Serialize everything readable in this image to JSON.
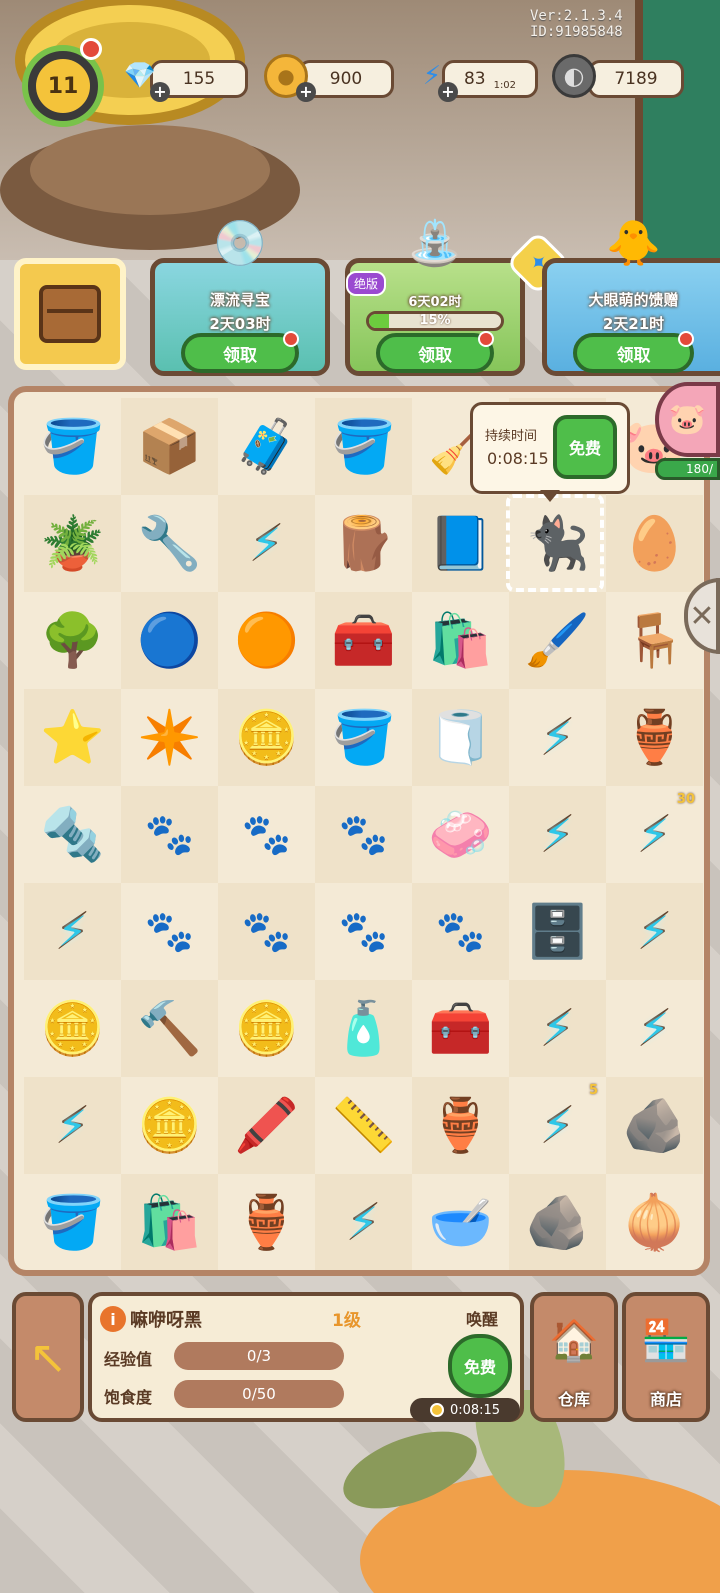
{
  "version": "Ver:2.1.3.4 ID:91985848",
  "player": {
    "level": "11"
  },
  "resources": [
    {
      "name": "gems",
      "icon": "💎",
      "color": "#e8446a",
      "value": "155"
    },
    {
      "name": "coins",
      "icon": "●",
      "color": "#f4b63a",
      "value": "900"
    },
    {
      "name": "energy",
      "icon": "⚡",
      "color": "#2e8de8",
      "value": "83",
      "timer": "1:02"
    },
    {
      "name": "seeds",
      "icon": "◐",
      "color": "#6a6a6a",
      "value": "7189"
    }
  ],
  "events": [
    {
      "title": "漂流寻宝",
      "time": "2天03时",
      "claim": "领取",
      "art": "💿"
    },
    {
      "title": "6天02时",
      "progress_label": "15%",
      "progress": 0.15,
      "badge": "绝版",
      "claim": "领取",
      "art": "⛲"
    },
    {
      "title": "大眼萌的馈赠",
      "time": "2天21时",
      "claim": "领取",
      "art": "🐥"
    }
  ],
  "tooltip": {
    "label": "持续时间",
    "time": "0:08:15",
    "free": "免费"
  },
  "pig_bank": {
    "value": "180/"
  },
  "board": {
    "rows": [
      [
        "🪣",
        "📦",
        "🧳",
        "🪣",
        "🧹",
        "",
        "🐷"
      ],
      [
        "🪴",
        "🔧",
        "⚡",
        "🪵",
        "📘",
        "🐈‍⬛",
        "🥚"
      ],
      [
        "🌳",
        "🔵",
        "🟠",
        "🧰",
        "🛍️",
        "🖌️",
        "🪑"
      ],
      [
        "⭐",
        "✴️",
        "🪙",
        "🪣",
        "🧻",
        "⚡",
        "🏺"
      ],
      [
        "🔩",
        "",
        "",
        "",
        "🧼",
        "⚡",
        "⚡"
      ],
      [
        "⚡",
        "",
        "",
        "",
        "",
        "🗄️",
        "⚡"
      ],
      [
        "🪙",
        "🔨",
        "🪙",
        "🧴",
        "🧰",
        "⚡",
        "⚡"
      ],
      [
        "⚡",
        "🪙",
        "🖍️",
        "📏",
        "🏺",
        "⚡",
        "🪨"
      ],
      [
        "🪣",
        "🛍️",
        "🏺",
        "⚡",
        "🥣",
        "🪨",
        "🧅"
      ]
    ],
    "bolt_cells": [
      [
        1,
        2
      ],
      [
        3,
        5
      ],
      [
        4,
        5
      ],
      [
        4,
        6
      ],
      [
        5,
        0
      ],
      [
        5,
        6
      ],
      [
        6,
        5
      ],
      [
        6,
        6
      ],
      [
        7,
        0
      ],
      [
        7,
        5
      ],
      [
        8,
        3
      ]
    ],
    "badges": [
      {
        "row": 4,
        "col": 6,
        "text": "30"
      },
      {
        "row": 7,
        "col": 5,
        "text": "5"
      }
    ]
  },
  "cat_info": {
    "name": "嘛咿呀黑",
    "level": "1级",
    "wake_label": "唤醒",
    "exp_label": "经验值",
    "exp_value": "0/3",
    "food_label": "饱食度",
    "food_value": "0/50",
    "free_label": "免费",
    "timer": "0:08:15"
  },
  "warehouse": {
    "label": "仓库",
    "icon": "🏠"
  },
  "shop": {
    "label": "商店",
    "icon": "🏪"
  }
}
